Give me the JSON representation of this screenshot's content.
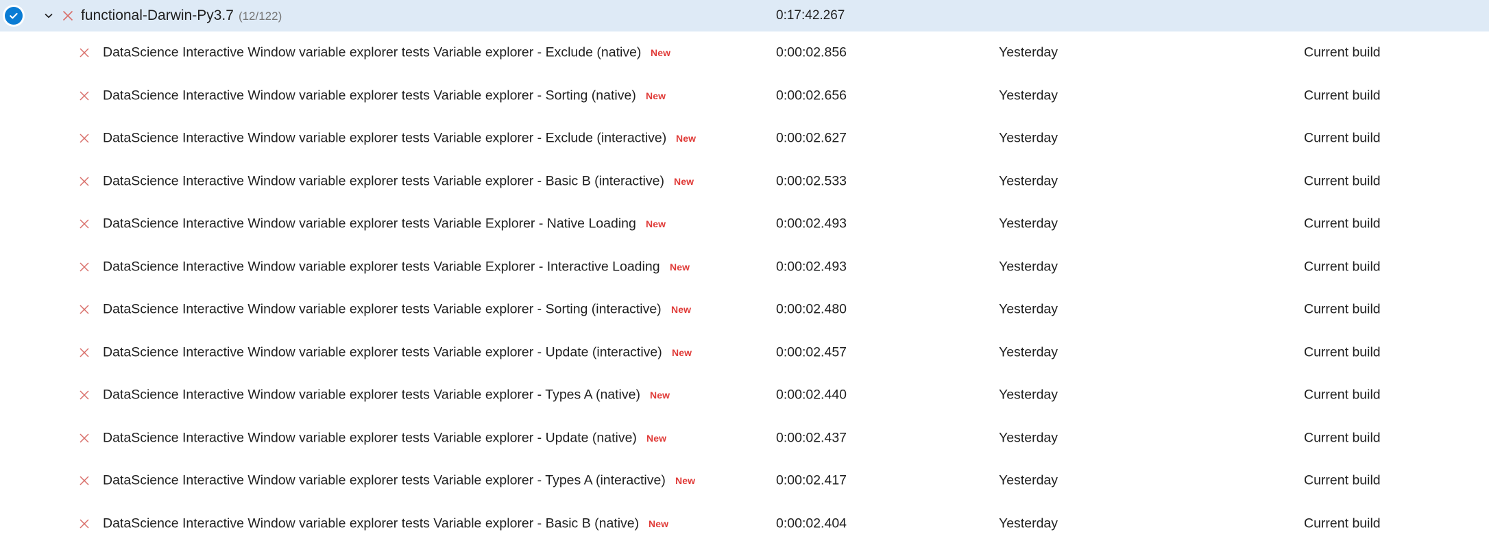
{
  "colors": {
    "header_background": "#deeaf6",
    "row_background": "#ffffff",
    "pass_icon": "#0a7cd4",
    "fail_icon": "#d96f6a",
    "new_badge": "#e03b38",
    "text": "#1f1f1f",
    "muted_text": "#767676"
  },
  "group": {
    "status_icon": "check-circle-icon",
    "expand_icon": "chevron-down-icon",
    "outcome_icon": "fail-x-icon",
    "title": "functional-Darwin-Py3.7",
    "count": "(12/122)",
    "duration": "0:17:42.267"
  },
  "rows": [
    {
      "outcome_icon": "fail-x-icon",
      "name": "DataScience Interactive Window variable explorer tests Variable explorer - Exclude (native)",
      "badge": "New",
      "duration": "0:00:02.856",
      "failing_since": "Yesterday",
      "build": "Current build"
    },
    {
      "outcome_icon": "fail-x-icon",
      "name": "DataScience Interactive Window variable explorer tests Variable explorer - Sorting (native)",
      "badge": "New",
      "duration": "0:00:02.656",
      "failing_since": "Yesterday",
      "build": "Current build"
    },
    {
      "outcome_icon": "fail-x-icon",
      "name": "DataScience Interactive Window variable explorer tests Variable explorer - Exclude (interactive)",
      "badge": "New",
      "duration": "0:00:02.627",
      "failing_since": "Yesterday",
      "build": "Current build"
    },
    {
      "outcome_icon": "fail-x-icon",
      "name": "DataScience Interactive Window variable explorer tests Variable explorer - Basic B (interactive)",
      "badge": "New",
      "duration": "0:00:02.533",
      "failing_since": "Yesterday",
      "build": "Current build"
    },
    {
      "outcome_icon": "fail-x-icon",
      "name": "DataScience Interactive Window variable explorer tests Variable Explorer - Native Loading",
      "badge": "New",
      "duration": "0:00:02.493",
      "failing_since": "Yesterday",
      "build": "Current build"
    },
    {
      "outcome_icon": "fail-x-icon",
      "name": "DataScience Interactive Window variable explorer tests Variable Explorer - Interactive Loading",
      "badge": "New",
      "duration": "0:00:02.493",
      "failing_since": "Yesterday",
      "build": "Current build"
    },
    {
      "outcome_icon": "fail-x-icon",
      "name": "DataScience Interactive Window variable explorer tests Variable explorer - Sorting (interactive)",
      "badge": "New",
      "duration": "0:00:02.480",
      "failing_since": "Yesterday",
      "build": "Current build"
    },
    {
      "outcome_icon": "fail-x-icon",
      "name": "DataScience Interactive Window variable explorer tests Variable explorer - Update (interactive)",
      "badge": "New",
      "duration": "0:00:02.457",
      "failing_since": "Yesterday",
      "build": "Current build"
    },
    {
      "outcome_icon": "fail-x-icon",
      "name": "DataScience Interactive Window variable explorer tests Variable explorer - Types A (native)",
      "badge": "New",
      "duration": "0:00:02.440",
      "failing_since": "Yesterday",
      "build": "Current build"
    },
    {
      "outcome_icon": "fail-x-icon",
      "name": "DataScience Interactive Window variable explorer tests Variable explorer - Update (native)",
      "badge": "New",
      "duration": "0:00:02.437",
      "failing_since": "Yesterday",
      "build": "Current build"
    },
    {
      "outcome_icon": "fail-x-icon",
      "name": "DataScience Interactive Window variable explorer tests Variable explorer - Types A (interactive)",
      "badge": "New",
      "duration": "0:00:02.417",
      "failing_since": "Yesterday",
      "build": "Current build"
    },
    {
      "outcome_icon": "fail-x-icon",
      "name": "DataScience Interactive Window variable explorer tests Variable explorer - Basic B (native)",
      "badge": "New",
      "duration": "0:00:02.404",
      "failing_since": "Yesterday",
      "build": "Current build"
    }
  ]
}
